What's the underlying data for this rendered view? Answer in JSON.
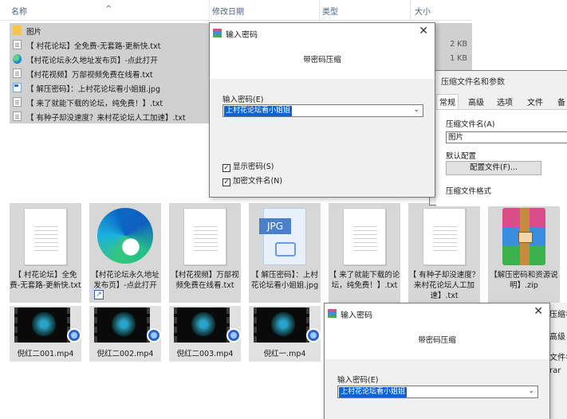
{
  "header": {
    "name": "名称",
    "modified": "修改日期",
    "type": "类型",
    "size": "大小"
  },
  "rows": [
    {
      "icon": "folder-icon",
      "name": "图片",
      "size": ""
    },
    {
      "icon": "text-file-icon",
      "name": "【 村花论坛】全免费-无套路-更新快.txt",
      "size": "2 KB"
    },
    {
      "icon": "edge-icon",
      "name": "【村花论坛永久地址发布页】-点此打开",
      "size": "1 KB"
    },
    {
      "icon": "text-file-icon",
      "name": "【村花视频】万部视频免费在线看.txt",
      "size": ""
    },
    {
      "icon": "image-file-icon",
      "name": "【 解压密码】：上村花论坛看小姐姐.jpg",
      "size": ""
    },
    {
      "icon": "text-file-icon",
      "name": "【 来了就能下载的论坛，纯免费！】.txt",
      "size": ""
    },
    {
      "icon": "text-file-icon",
      "name": "【 有种子却没速度？来村花论坛人工加速】.txt",
      "size": ""
    }
  ],
  "tiles": [
    {
      "icon": "text-file-icon",
      "caption": "【 村花论坛】全免费-无套路-更新快.txt"
    },
    {
      "icon": "edge-icon",
      "caption": "【村花论坛永久地址发布页】-点此打开"
    },
    {
      "icon": "text-file-icon",
      "caption": "【村花视频】万部视频免费在线看.txt"
    },
    {
      "icon": "jpg-file-icon",
      "badge": "JPG",
      "caption": "【 解压密码】：上村花论坛看小姐姐.jpg"
    },
    {
      "icon": "text-file-icon",
      "caption": "【 来了就能下载的论坛，纯免费！】.txt"
    },
    {
      "icon": "text-file-icon",
      "caption": "【 有种子却没速度？来村花论坛人工加速】.txt"
    },
    {
      "icon": "winrar-archive-icon",
      "caption": "【解压密码和资源说明】.zip"
    }
  ],
  "videos": [
    {
      "caption": "倪红二001.mp4"
    },
    {
      "caption": "倪红二002.mp4"
    },
    {
      "caption": "倪红二003.mp4"
    },
    {
      "caption": "倪红一.mp4"
    }
  ],
  "password_dialog": {
    "title": "输入密码",
    "subtitle": "带密码压缩",
    "field_label": "输入密码(E)",
    "field_value": "上村花论坛看小姐姐",
    "show_password": "显示密码(S)",
    "encrypt_names": "加密文件名(N)"
  },
  "password_dialog_2": {
    "title": "输入密码",
    "subtitle": "带密码压缩",
    "field_label": "输入密码(E)",
    "field_value": "上村花论坛看小姐姐"
  },
  "archive_window": {
    "title": "压缩文件名和参数",
    "tabs": [
      "常规",
      "高级",
      "选项",
      "文件",
      "备"
    ],
    "archive_name_label": "压缩文件名(A)",
    "archive_name_value": "图片",
    "default_profile_label": "默认配置",
    "profile_button": "配置文件(F)...",
    "format_label": "压缩文件格式"
  },
  "archive_window_2": {
    "frag1": "压缩名",
    "frag2": "高级",
    "frag3": "文件名",
    "frag4": "rar"
  }
}
